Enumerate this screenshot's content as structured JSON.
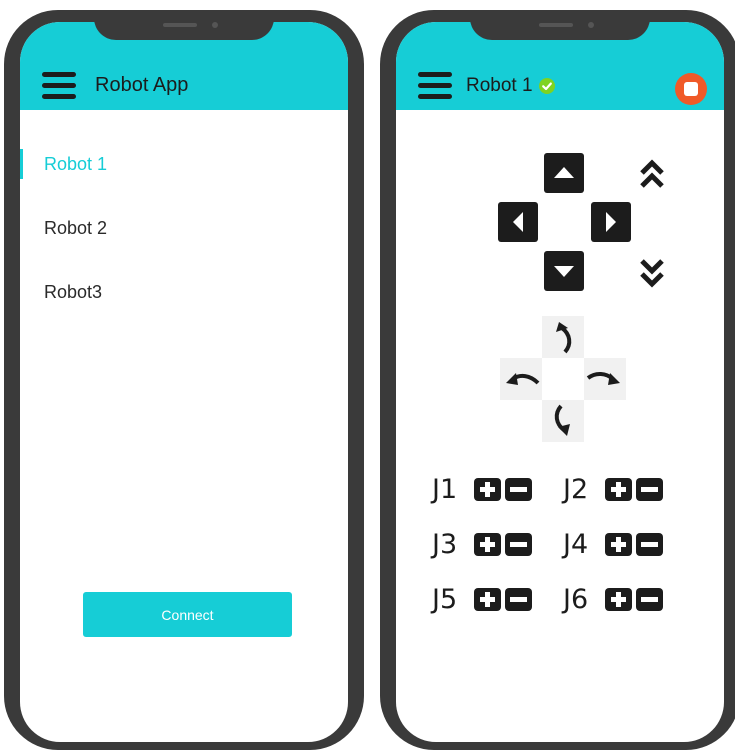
{
  "left_phone": {
    "title": "Robot App",
    "robots": [
      {
        "label": "Robot 1",
        "active": true
      },
      {
        "label": "Robot 2",
        "active": false
      },
      {
        "label": "Robot3",
        "active": false
      }
    ],
    "connect_label": "Connect"
  },
  "right_phone": {
    "title": "Robot 1",
    "status_color": "#7ed321",
    "stop_color": "#f05a28",
    "joints": [
      "J1",
      "J2",
      "J3",
      "J4",
      "J5",
      "J6"
    ]
  },
  "colors": {
    "accent": "#16cdd6",
    "phone_frame": "#3a3a3a",
    "control": "#1c1c1c"
  }
}
